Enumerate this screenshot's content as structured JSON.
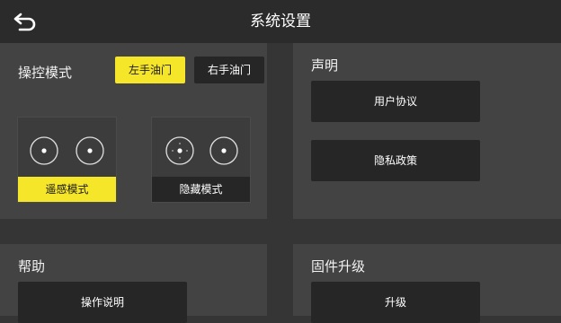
{
  "header": {
    "title": "系统设置",
    "back_icon": "back-arrow-icon"
  },
  "control_mode": {
    "title": "操控模式",
    "throttle_options": [
      {
        "label": "左手油门",
        "selected": true
      },
      {
        "label": "右手油门",
        "selected": false
      }
    ],
    "modes": [
      {
        "label": "遥感模式",
        "selected": true
      },
      {
        "label": "隐藏模式",
        "selected": false
      }
    ]
  },
  "statement": {
    "title": "声明",
    "buttons": [
      {
        "label": "用户协议"
      },
      {
        "label": "隐私政策"
      }
    ]
  },
  "help": {
    "title": "帮助",
    "buttons": [
      {
        "label": "操作说明"
      }
    ]
  },
  "firmware": {
    "title": "固件升级",
    "buttons": [
      {
        "label": "升级"
      }
    ]
  },
  "colors": {
    "accent": "#f5e62a",
    "background": "#353535",
    "panel": "#434343",
    "button": "#262626"
  }
}
